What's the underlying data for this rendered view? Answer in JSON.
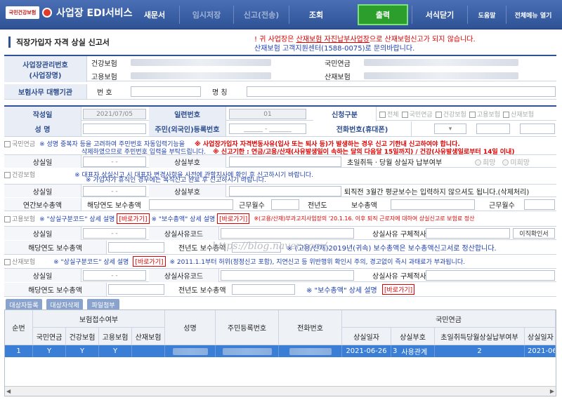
{
  "nav": {
    "logo_badge": "국민건강보험",
    "title": "사업장 EDI서비스",
    "items": [
      "새문서",
      "임시저장",
      "신고(전송)",
      "조회",
      "출력",
      "서식닫기",
      "도움말",
      "전체메뉴 열기"
    ]
  },
  "page": {
    "title": "직장가입자 자격 상실 신고서"
  },
  "notice": {
    "line1_a": "! 귀 사업장은",
    "line1_b": "산재보험 자진납부사업장",
    "line1_c": "으로 산재보험신고가 되지 않습니다.",
    "line2": "산재보험 고객지원센터(1588-0075)로 문의바랍니다."
  },
  "employer": {
    "mgmt_label": "사업장관리번호\n(사업장명)",
    "health": "건강보험",
    "employ": "고용보험",
    "pension": "국민연금",
    "accident": "산재보험",
    "agency_label": "보험사무 대행기관",
    "num_label": "번 호",
    "name_label": "명 칭"
  },
  "form": {
    "date_label": "작성일",
    "date_value": "2021/07/05",
    "serial_label": "일련번호",
    "serial_value": "01",
    "apply_label": "신청구분",
    "apply_opts": [
      "전체",
      "국민연금",
      "건강보험",
      "고용보험",
      "산재보험"
    ],
    "name_label": "성 명",
    "rrn_label": "주민(외국인)등록번호",
    "rrn_value": "______ - _______",
    "phone_label": "전화번호(휴대폰)"
  },
  "pension": {
    "tag": "국민연금",
    "note1": "※ 성명 중복자 등을 고려하여 주민번호 자동입력기능을",
    "note2": "삭제하였으므로 주민번호 입력을 부탁드립니다.",
    "warn1": "※ 사업장가입자 자격변동사유(입사 또는 퇴사 등)가 발생하는 경우 신고 기한내 신고하여야 합니다.",
    "warn2": "※ 신고기한 : 연금/고용/산재(사유발생일이 속하는 달의 다음달 15일까지) / 건강(사유발생일로부터 14일 이내)",
    "loss_date": "상실일",
    "loss_date_val": "-  -",
    "loss_code": "상실부호",
    "first_month": "초일취득ㆍ당월 상실자 납부여부",
    "opt_yes": "희망",
    "opt_no": "미희망"
  },
  "health": {
    "tag": "건강보험",
    "note1": "※ 대표자 상실신고 시 대표자 변경사항을 사전에 관할지사에 확인 후 신고하시기 바랍니다.",
    "note2": "※ 가입자가 휴직인 경우에는 복직신고 완료 후 신고하시기 바랍니다.",
    "loss_date": "상실일",
    "loss_date_val": "-  -",
    "loss_code": "상실부호",
    "retire_note": "퇴직전 3월간 평균보수는 입력하지 않으셔도 됩니다.(삭제처리)",
    "annual_total": "연간보수총액",
    "year_total": "해당연도 보수총액",
    "months": "근무월수",
    "prev_year": "전년도",
    "pay_total": "보수총액",
    "months2": "근무월수"
  },
  "employment": {
    "tag": "고용보험",
    "note_a": "※ \"상실구분코드\" 상세 설명",
    "link1": "[바로가기]",
    "note_b": "※ \"보수총액\" 상세 설명",
    "link2": "[바로가기]",
    "note_c": "※(고용/산재)부과고지사업장의 '20.1.16. 이후 퇴직 근로자에 대하여 상실신고로 보험료 정산",
    "loss_date": "상실일",
    "loss_date_val": "-  -",
    "reason_code": "상실사유코드",
    "reason_detail": "상실사유 구체적사유",
    "transfer_btn": "이직확인서",
    "year_total": "해당연도 보수총액",
    "prev_total": "전년도 보수총액",
    "settle_note": "※ (고용/산재)2019년(귀속) 보수총액은 보수총액신고서로 정산합니다."
  },
  "accident": {
    "tag": "산재보험",
    "note_a": "※ \"상실구분코드\" 상세 설명",
    "link1": "[바로가기]",
    "note_b": "※ 2011.1.1부터 허위(정정신고 포함), 지연신고 등 위반행위 확인시 주의, 경고없이 즉시 과태료가 부과됩니다.",
    "loss_date": "상실일",
    "loss_date_val": "-  -",
    "reason_code": "상실사유코드",
    "reason_detail": "상실사유 구체적사유",
    "year_total": "해당연도 보수총액",
    "prev_total": "전년도 보수총액",
    "pay_note": "※ \"보수총액\" 상세 설명",
    "link2": "[바로가기]"
  },
  "actions": [
    "대상자등록",
    "대상자삭제",
    "파일첨부"
  ],
  "watermark": "https://blog.naver.com/...",
  "grid": {
    "h_no": "순번",
    "h_insure": "보험접수여부",
    "h_sub": [
      "국민연금",
      "건강보험",
      "고용보험",
      "산재보험"
    ],
    "h_name": "성명",
    "h_rrn": "주민등록번호",
    "h_phone": "전화번호",
    "h_pension": "국민연금",
    "h_pension_sub": [
      "상실일자",
      "상실부호",
      "초일취득당월상실납부여부",
      "상실일자"
    ],
    "row": {
      "no": "1",
      "p": "Y",
      "h": "Y",
      "e": "Y",
      "a": "",
      "date": "2021-06-26",
      "code": "3",
      "code_text": "사용관계",
      "first": "2",
      "date2": "2021-06-"
    }
  }
}
